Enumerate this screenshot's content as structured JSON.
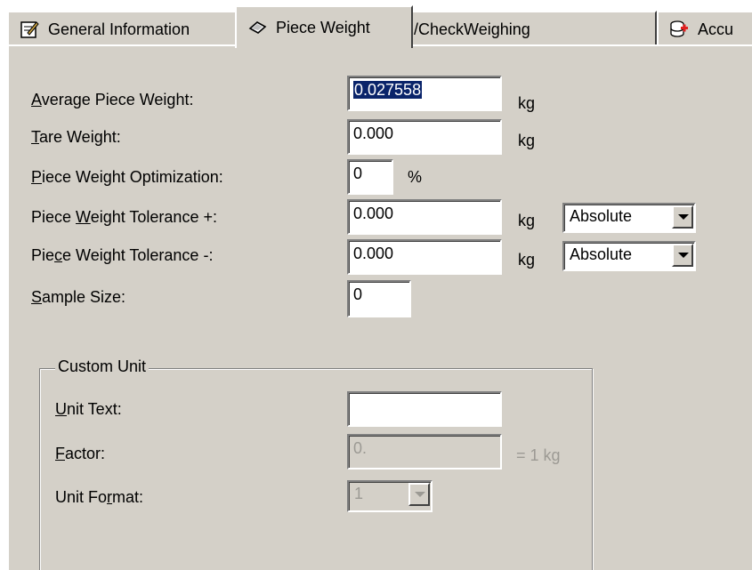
{
  "tabs": [
    {
      "label": "General Information",
      "icon": "edit-document-icon"
    },
    {
      "label": "Piece Weight",
      "icon": "weight-piece-icon",
      "selected": true
    },
    {
      "label": "Filling/CheckWeighing",
      "icon": "filling-icon"
    },
    {
      "label": "Accu",
      "icon": "accumulation-icon"
    }
  ],
  "fields": {
    "average_piece_weight": {
      "label_u": "A",
      "label_rest": "verage Piece Weight:",
      "value": "0.027558",
      "unit": "kg"
    },
    "tare_weight": {
      "label_u": "T",
      "label_rest": "are Weight:",
      "value": "0.000",
      "unit": "kg"
    },
    "optimization": {
      "label_u": "P",
      "label_rest": "iece Weight Optimization:",
      "value": "0",
      "unit": "%"
    },
    "tol_plus": {
      "label_pre": "Piece ",
      "label_u": "W",
      "label_rest": "eight Tolerance +:",
      "value": "0.000",
      "unit": "kg",
      "mode": "Absolute"
    },
    "tol_minus": {
      "label_pre": "Pie",
      "label_u": "c",
      "label_rest": "e Weight Tolerance -:",
      "value": "0.000",
      "unit": "kg",
      "mode": "Absolute"
    },
    "sample_size": {
      "label_u": "S",
      "label_rest": "ample Size:",
      "value": "0"
    }
  },
  "custom_unit": {
    "title": "Custom Unit",
    "unit_text": {
      "label_u": "U",
      "label_rest": "nit Text:",
      "value": ""
    },
    "factor": {
      "label_u": "F",
      "label_rest": "actor:",
      "value": "0.",
      "suffix": "= 1 kg"
    },
    "unit_format": {
      "label_pre": "Unit Fo",
      "label_u": "r",
      "label_rest": "mat:",
      "value": "1"
    }
  }
}
